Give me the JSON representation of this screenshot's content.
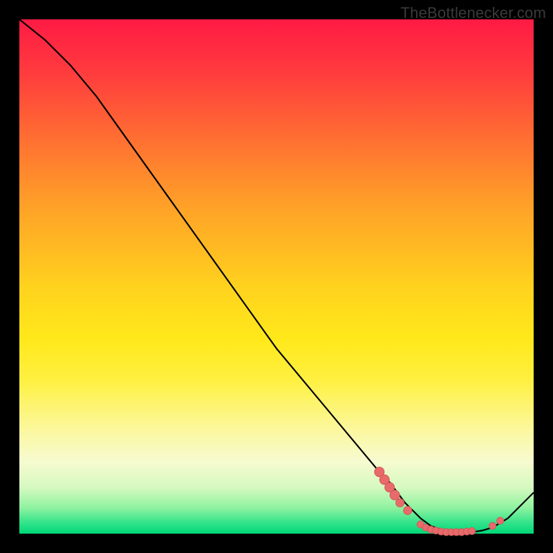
{
  "watermark": "TheBottlenecker.com",
  "colors": {
    "curve": "#000000",
    "marker_fill": "#e96a6a",
    "marker_stroke": "#cf5a5a"
  },
  "chart_data": {
    "type": "line",
    "title": "",
    "xlabel": "",
    "ylabel": "",
    "xlim": [
      0,
      100
    ],
    "ylim": [
      0,
      100
    ],
    "series": [
      {
        "name": "bottleneck-curve",
        "x": [
          0,
          5,
          10,
          15,
          20,
          25,
          30,
          35,
          40,
          45,
          50,
          55,
          60,
          65,
          70,
          72,
          75,
          78,
          80,
          82,
          85,
          88,
          90,
          92,
          95,
          100
        ],
        "y": [
          100,
          96,
          91,
          85,
          78,
          71,
          64,
          57,
          50,
          43,
          36,
          30,
          24,
          18,
          12,
          10,
          6,
          3,
          1.5,
          0.8,
          0.3,
          0.3,
          0.6,
          1.2,
          3,
          8
        ]
      }
    ],
    "markers": [
      {
        "x": 70,
        "y": 12,
        "r": 7
      },
      {
        "x": 71,
        "y": 10.5,
        "r": 7
      },
      {
        "x": 72,
        "y": 9,
        "r": 7
      },
      {
        "x": 73,
        "y": 7.5,
        "r": 7
      },
      {
        "x": 74,
        "y": 6,
        "r": 6
      },
      {
        "x": 75.5,
        "y": 4.5,
        "r": 6
      },
      {
        "x": 78,
        "y": 1.8,
        "r": 5
      },
      {
        "x": 79,
        "y": 1.2,
        "r": 5
      },
      {
        "x": 80,
        "y": 0.8,
        "r": 5
      },
      {
        "x": 81,
        "y": 0.6,
        "r": 5
      },
      {
        "x": 82,
        "y": 0.4,
        "r": 5
      },
      {
        "x": 83,
        "y": 0.3,
        "r": 5
      },
      {
        "x": 84,
        "y": 0.3,
        "r": 5
      },
      {
        "x": 85,
        "y": 0.3,
        "r": 5
      },
      {
        "x": 86,
        "y": 0.3,
        "r": 5
      },
      {
        "x": 87,
        "y": 0.4,
        "r": 5
      },
      {
        "x": 88,
        "y": 0.5,
        "r": 5
      },
      {
        "x": 92,
        "y": 1.5,
        "r": 5
      },
      {
        "x": 93.5,
        "y": 2.5,
        "r": 5
      }
    ]
  }
}
